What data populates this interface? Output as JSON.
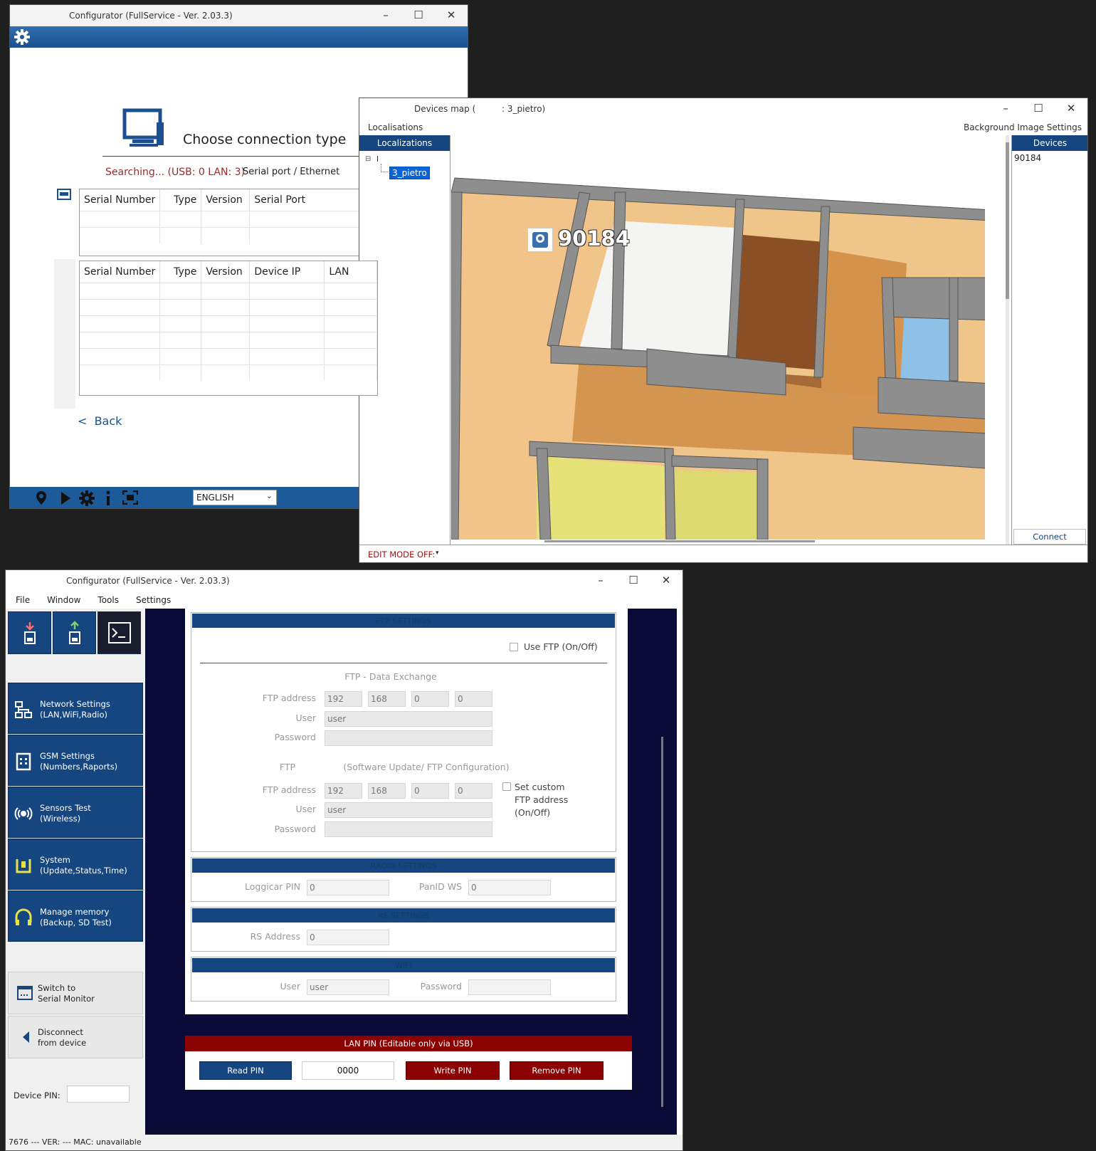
{
  "w1": {
    "title": "Configurator (FullService - Ver. 2.03.3)",
    "heading": "Choose connection type",
    "searching": "Searching... (USB: 0 LAN: 3)",
    "connection_type": "Serial port / Ethernet",
    "usb_cols": [
      "Serial Number",
      "Type",
      "Version",
      "Serial Port"
    ],
    "lan_cols": [
      "Serial Number",
      "Type",
      "Version",
      "Device IP",
      "LAN"
    ],
    "back": "Back",
    "back_arrow": "<",
    "language": "ENGLISH"
  },
  "w2": {
    "title": "Devices map (",
    "title_suffix": ": 3_pietro)",
    "tab_localisations": "Localisations",
    "tab_bg_settings": "Background Image Settings",
    "localizations_head": "Localizations",
    "tree_root": "l",
    "tree_child": "3_pietro",
    "map_marker": "90184",
    "devices_head": "Devices",
    "devices": [
      "90184"
    ],
    "connect": "Connect",
    "edit_mode": "EDIT MODE OFF:"
  },
  "w3": {
    "title": "Configurator (FullService - Ver. 2.03.3)",
    "menu": [
      "File",
      "Window",
      "Tools",
      "Settings"
    ],
    "nav": [
      {
        "line1": "Network Settings",
        "line2": "(LAN,WiFi,Radio)",
        "icon": "network-icon"
      },
      {
        "line1": "GSM Settings",
        "line2": "(Numbers,Raports)",
        "icon": "gsm-icon"
      },
      {
        "line1": "Sensors Test",
        "line2": "(Wireless)",
        "icon": "sensor-icon"
      },
      {
        "line1": "System",
        "line2": "(Update,Status,Time)",
        "icon": "system-icon"
      },
      {
        "line1": "Manage memory",
        "line2": "(Backup, SD Test)",
        "icon": "memory-icon"
      }
    ],
    "switch_line1": "Switch to",
    "switch_line2": "Serial Monitor",
    "disconnect_line1": "Disconnect",
    "disconnect_line2": "from device",
    "device_pin_label": "Device PIN:",
    "ftp": {
      "head": "FTP SETTINGS",
      "use_ftp": "Use FTP (On/Off)",
      "data_exchange": "FTP - Data Exchange",
      "ftp_address_label": "FTP address",
      "ip1": [
        "192",
        "168",
        "0",
        "0"
      ],
      "user_label": "User",
      "user_value": "user",
      "password_label": "Password",
      "ftp_label": "FTP",
      "software_update": "(Software Update/ FTP Configuration)",
      "ip2": [
        "192",
        "168",
        "0",
        "0"
      ],
      "user2_value": "user",
      "set_custom_1": "Set custom",
      "set_custom_2": "FTP address",
      "set_custom_3": "(On/Off)"
    },
    "radio": {
      "head": "RADIO SETTINGS",
      "loggicar_label": "Loggicar PIN",
      "loggicar_value": "0",
      "panid_label": "PanID WS",
      "panid_value": "0"
    },
    "rs": {
      "head": "RS SETTINGS",
      "address_label": "RS Address",
      "address_value": "0"
    },
    "wifi": {
      "head": "WIFI",
      "user_label": "User",
      "user_value": "user",
      "password_label": "Password"
    },
    "lanpin": {
      "head": "LAN PIN (Editable only via USB)",
      "read": "Read PIN",
      "value": "0000",
      "write": "Write PIN",
      "remove": "Remove PIN"
    },
    "status": "7676  --- VER: ---  MAC:  unavailable"
  },
  "colors": {
    "navy": "#15467f",
    "dark_red": "#8b0000",
    "content_bg": "#0a0a36"
  }
}
